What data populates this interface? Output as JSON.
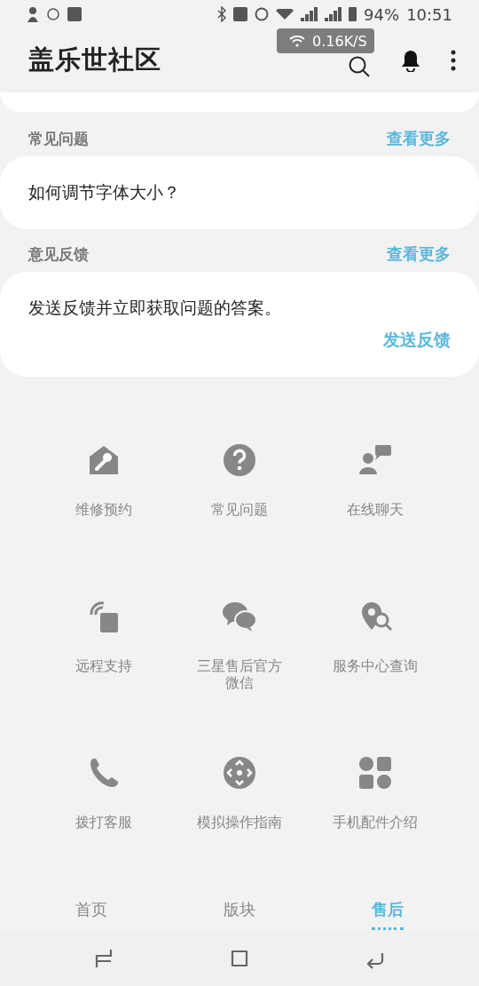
{
  "status_bar": {
    "battery": "94%",
    "time": "10:51"
  },
  "speed_overlay": "0.16K/S",
  "app_bar": {
    "title": "盖乐世社区"
  },
  "sections": [
    {
      "title": "常见问题",
      "more": "查看更多",
      "text": "如何调节字体大小？"
    },
    {
      "title": "意见反馈",
      "more": "查看更多",
      "text": "发送反馈并立即获取问题的答案。",
      "action": "发送反馈"
    }
  ],
  "services": [
    {
      "label": "维修预约"
    },
    {
      "label": "常见问题"
    },
    {
      "label": "在线聊天"
    },
    {
      "label": "远程支持"
    },
    {
      "label": "三星售后官方微信"
    },
    {
      "label": "服务中心查询"
    },
    {
      "label": "拨打客服"
    },
    {
      "label": "模拟操作指南"
    },
    {
      "label": "手机配件介绍"
    }
  ],
  "tabs": [
    {
      "label": "首页",
      "selected": false
    },
    {
      "label": "版块",
      "selected": false
    },
    {
      "label": "售后",
      "selected": true
    }
  ]
}
